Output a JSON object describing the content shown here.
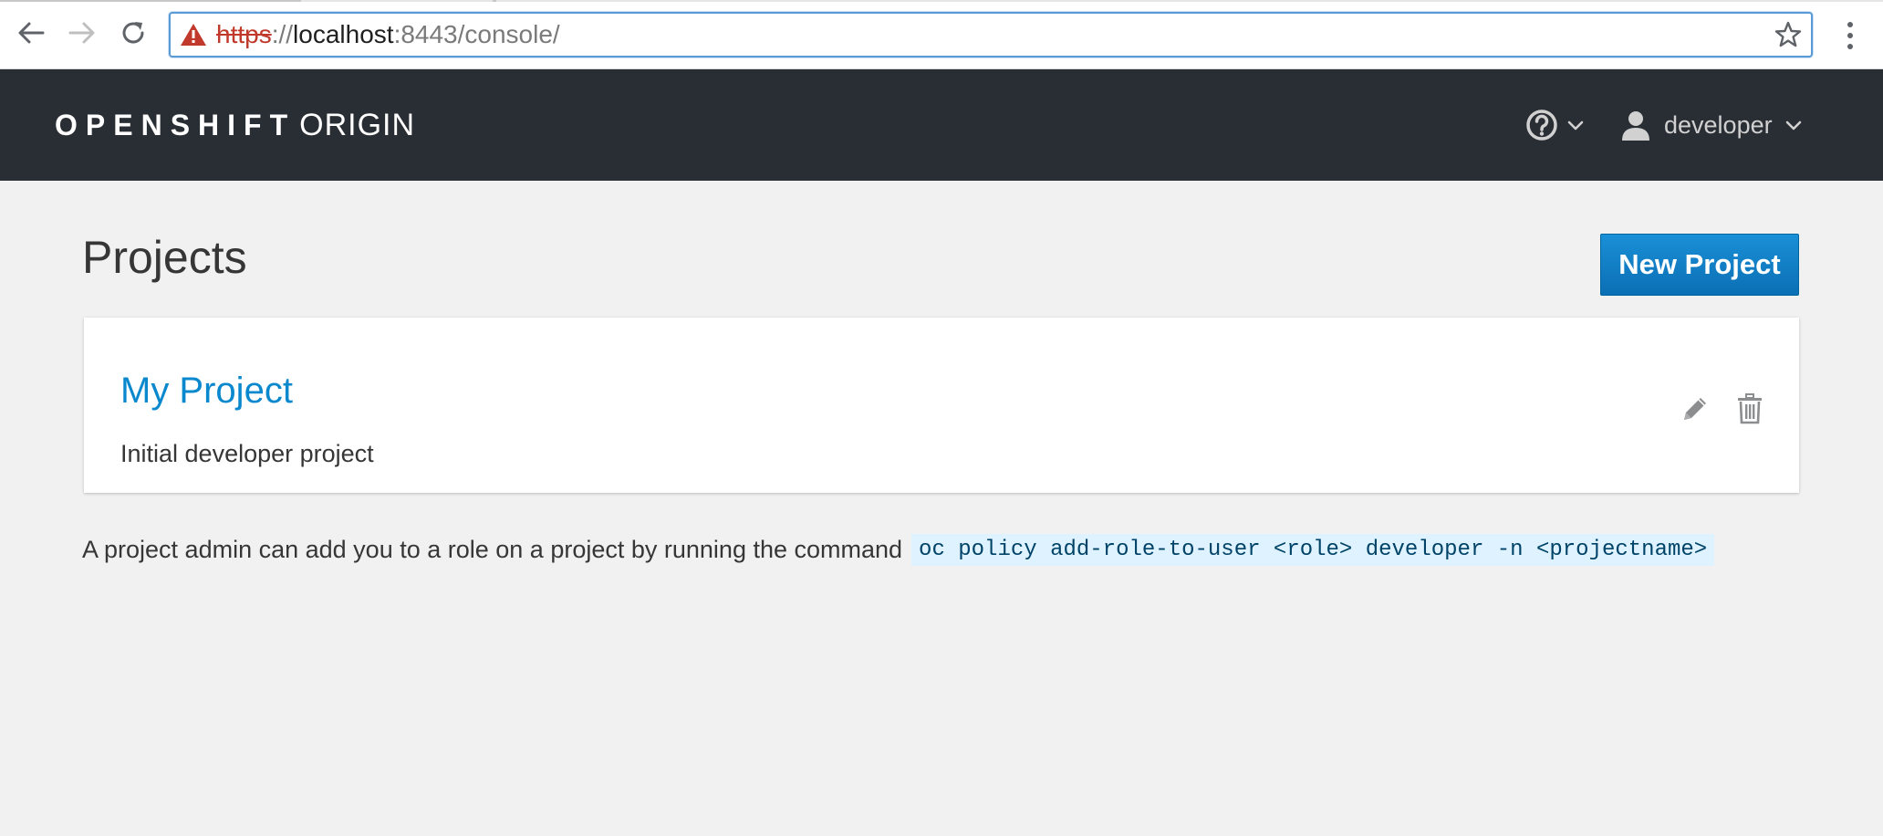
{
  "browser": {
    "url": {
      "scheme": "https",
      "separator": "://",
      "host": "localhost",
      "rest": ":8443/console/"
    },
    "icons": {
      "back": "arrow-left-icon",
      "forward": "arrow-right-icon",
      "reload": "reload-icon",
      "security": "warning-icon",
      "bookmark": "star-icon",
      "menu": "three-dots-icon"
    }
  },
  "header": {
    "brand_strong": "OPENSHIFT",
    "brand_light": "ORIGIN",
    "help_icon": "question-circle-icon",
    "user": {
      "name": "developer",
      "icon": "user-icon"
    },
    "colors": {
      "background": "#292e34"
    }
  },
  "main": {
    "title": "Projects",
    "new_project_label": "New Project",
    "projects": [
      {
        "name": "My Project",
        "description": "Initial developer project",
        "actions": [
          "pencil-icon",
          "trash-icon"
        ]
      }
    ],
    "hint": {
      "text": "A project admin can add you to a role on a project by running the command",
      "command": "oc policy add-role-to-user <role> developer -n <projectname>"
    },
    "colors": {
      "link": "#0a88ce",
      "primary": "#0b80c9",
      "code_bg": "#def3ff"
    }
  }
}
